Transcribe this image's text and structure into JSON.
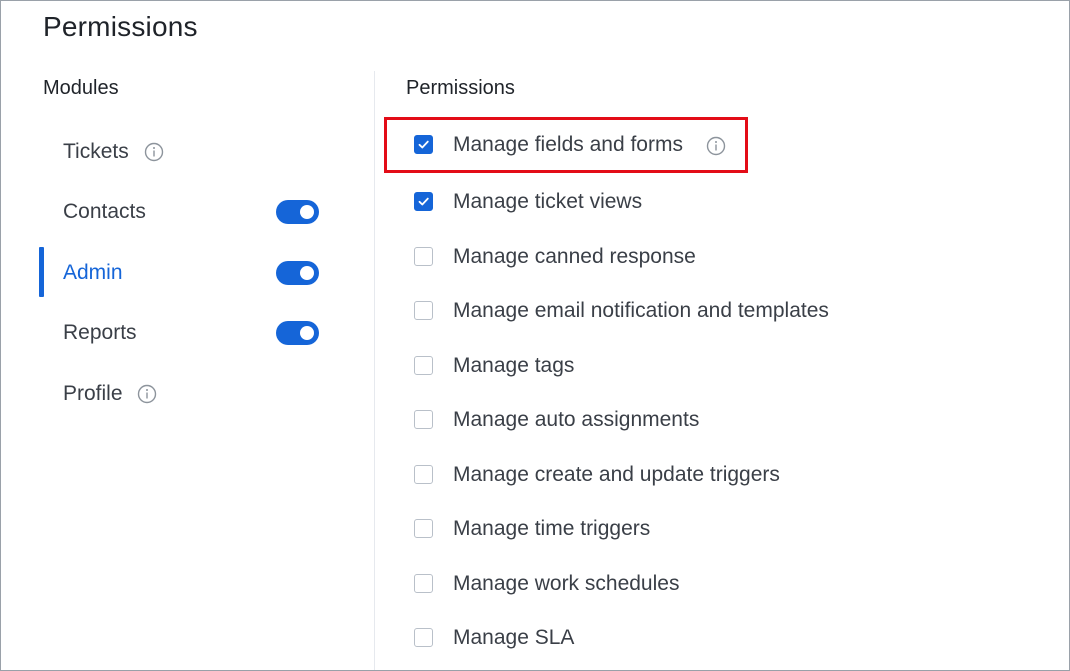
{
  "page": {
    "title": "Permissions"
  },
  "modules": {
    "header": "Modules",
    "items": [
      {
        "label": "Tickets",
        "info": true,
        "toggle": null,
        "active": false
      },
      {
        "label": "Contacts",
        "info": false,
        "toggle": "on",
        "active": false
      },
      {
        "label": "Admin",
        "info": false,
        "toggle": "on",
        "active": true
      },
      {
        "label": "Reports",
        "info": false,
        "toggle": "on",
        "active": false
      },
      {
        "label": "Profile",
        "info": true,
        "toggle": null,
        "active": false
      }
    ]
  },
  "permissions": {
    "header": "Permissions",
    "items": [
      {
        "label": "Manage fields and forms",
        "checked": true,
        "info": true,
        "highlighted": true
      },
      {
        "label": "Manage ticket views",
        "checked": true,
        "info": false
      },
      {
        "label": "Manage canned response",
        "checked": false,
        "info": false
      },
      {
        "label": "Manage email notification and templates",
        "checked": false,
        "info": false
      },
      {
        "label": "Manage tags",
        "checked": false,
        "info": false
      },
      {
        "label": "Manage auto assignments",
        "checked": false,
        "info": false
      },
      {
        "label": "Manage create and update triggers",
        "checked": false,
        "info": false
      },
      {
        "label": "Manage time triggers",
        "checked": false,
        "info": false
      },
      {
        "label": "Manage work schedules",
        "checked": false,
        "info": false
      },
      {
        "label": "Manage SLA",
        "checked": false,
        "info": false
      }
    ]
  },
  "colors": {
    "accent": "#1565d8",
    "highlight": "#e30c17",
    "text": "#3a3f47"
  },
  "icons": {
    "info": "info-circle-icon",
    "check": "check-icon"
  }
}
